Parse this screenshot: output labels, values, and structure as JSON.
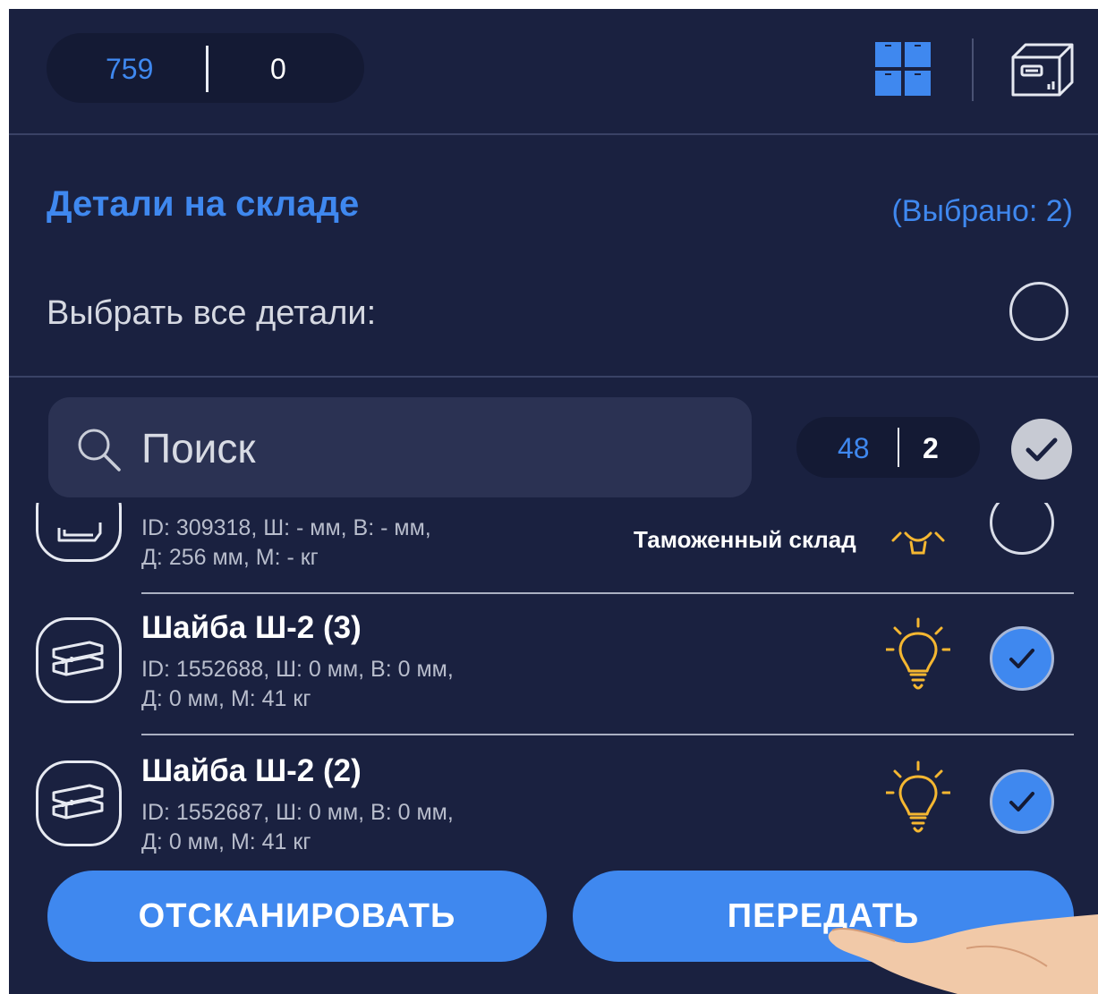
{
  "header": {
    "counter_total": "759",
    "counter_selected": "0",
    "grid_icon": "grid-icon",
    "box_icon": "package-icon"
  },
  "section": {
    "title": "Детали на складе",
    "selected_count": "(Выбрано: 2)",
    "select_all_label": "Выбрать все детали:"
  },
  "search": {
    "placeholder": "Поиск",
    "count_total": "48",
    "count_selected": "2"
  },
  "items": [
    {
      "name": "",
      "meta_line1": "ID: 309318, Ш: - мм, В: - мм,",
      "meta_line2": "Д: 256 мм, М: - кг",
      "warehouse": "Таможенный склад",
      "checked": false
    },
    {
      "name": "Шайба Ш-2 (3)",
      "meta_line1": "ID: 1552688, Ш: 0 мм, В: 0 мм,",
      "meta_line2": "Д: 0 мм, М: 41 кг",
      "warehouse": "",
      "checked": true
    },
    {
      "name": "Шайба Ш-2 (2)",
      "meta_line1": "ID: 1552687, Ш: 0 мм, В: 0 мм,",
      "meta_line2": "Д: 0 мм, М: 41 кг",
      "warehouse": "",
      "checked": true
    }
  ],
  "buttons": {
    "scan": "ОТСКАНИРОВАТЬ",
    "transfer": "ПЕРЕДАТЬ"
  },
  "colors": {
    "background": "#1a2140",
    "accent": "#3f88ef",
    "bulb": "#f5b731"
  }
}
